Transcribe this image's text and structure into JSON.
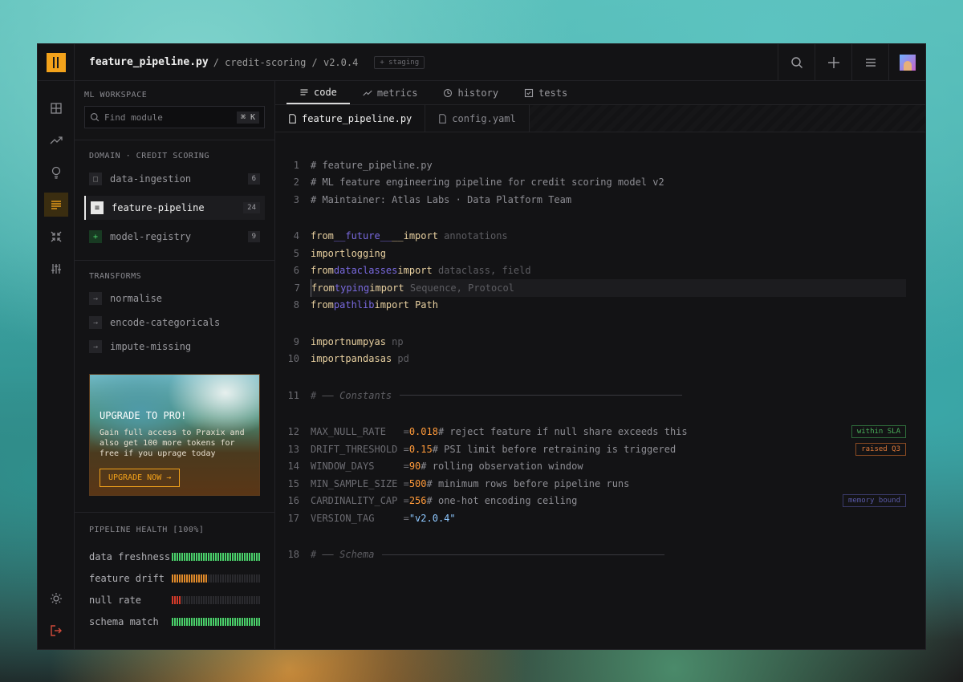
{
  "breadcrumb": {
    "file": "feature_pipeline.py",
    "rest": "/ credit-scoring / v2.0.4",
    "env": "+ staging"
  },
  "sidebar": {
    "workspace_label": "ML WORKSPACE",
    "search_placeholder": "Find module",
    "search_shortcut": "⌘ K",
    "domain_label": "DOMAIN · CREDIT SCORING",
    "modules": [
      {
        "name": "data-ingestion",
        "count": "6"
      },
      {
        "name": "feature-pipeline",
        "count": "24"
      },
      {
        "name": "model-registry",
        "count": "9"
      }
    ],
    "transforms_label": "TRANSFORMS",
    "transforms": [
      "normalise",
      "encode-categoricals",
      "impute-missing"
    ]
  },
  "promo": {
    "title": "UPGRADE TO PRO!",
    "text": "Gain full access to Praxix and also get 100 more tokens for free if you uprage today",
    "button": "UPGRADE NOW →"
  },
  "health": {
    "label": "PIPELINE HEALTH [100%]",
    "rows": [
      {
        "name": "data freshness",
        "level": 1.0,
        "color": "#4ad06a"
      },
      {
        "name": "feature drift",
        "level": 0.4,
        "color": "#e08a2a"
      },
      {
        "name": "null rate",
        "level": 0.1,
        "color": "#d23a2a"
      },
      {
        "name": "schema match",
        "level": 1.0,
        "color": "#4ad06a"
      }
    ]
  },
  "tabs": [
    "code",
    "metrics",
    "history",
    "tests"
  ],
  "file_tabs": [
    "feature_pipeline.py",
    "config.yaml"
  ],
  "code": {
    "l1": "# feature_pipeline.py",
    "l2": "# ML feature engineering pipeline for credit scoring model v2",
    "l3": "# Maintainer: Atlas Labs · Data Platform Team",
    "l4": {
      "kw": "from",
      "mod": "__future__",
      "kw2": "__import",
      "rest": " annotations"
    },
    "l5": {
      "kw": "import",
      "id": "logging"
    },
    "l6": {
      "kw": "from",
      "mod": "dataclasses",
      "kw2": "import",
      "rest": " dataclass, field"
    },
    "l7": {
      "kw": "from",
      "mod": "typing",
      "kw2": "import",
      "rest": " Sequence, Protocol"
    },
    "l8": {
      "kw": "from",
      "mod": "pathlib",
      "kw2": "import",
      "rest": " Path"
    },
    "l9": {
      "kw": "import",
      "id": "numpy",
      "as": "as",
      "alias": " np"
    },
    "l10": {
      "kw": "import",
      "id": "pandas",
      "as": "as",
      "alias": " pd"
    },
    "l11": "# —— Constants",
    "l12": {
      "name": "MAX_NULL_RATE   =",
      "val": "0.018",
      "cm": "# reject feature if null share exceeds this",
      "tag": "within SLA"
    },
    "l13": {
      "name": "DRIFT_THRESHOLD =",
      "val": "0.15",
      "cm": "# PSI limit before retraining is triggered",
      "tag": "raised Q3"
    },
    "l14": {
      "name": "WINDOW_DAYS     =",
      "val": "90",
      "cm": "# rolling observation window"
    },
    "l15": {
      "name": "MIN_SAMPLE_SIZE =",
      "val": "500",
      "cm": "# minimum rows before pipeline runs"
    },
    "l16": {
      "name": "CARDINALITY_CAP =",
      "val": "256",
      "cm": "# one-hot encoding ceiling",
      "tag": "memory bound"
    },
    "l17": {
      "name": "VERSION_TAG     =",
      "val": "\"v2.0.4\""
    },
    "l18": "# —— Schema"
  },
  "line_numbers": [
    "1",
    "2",
    "3",
    "4",
    "5",
    "6",
    "7",
    "8",
    "9",
    "10",
    "11",
    "12",
    "13",
    "14",
    "15",
    "16",
    "17",
    "18"
  ]
}
